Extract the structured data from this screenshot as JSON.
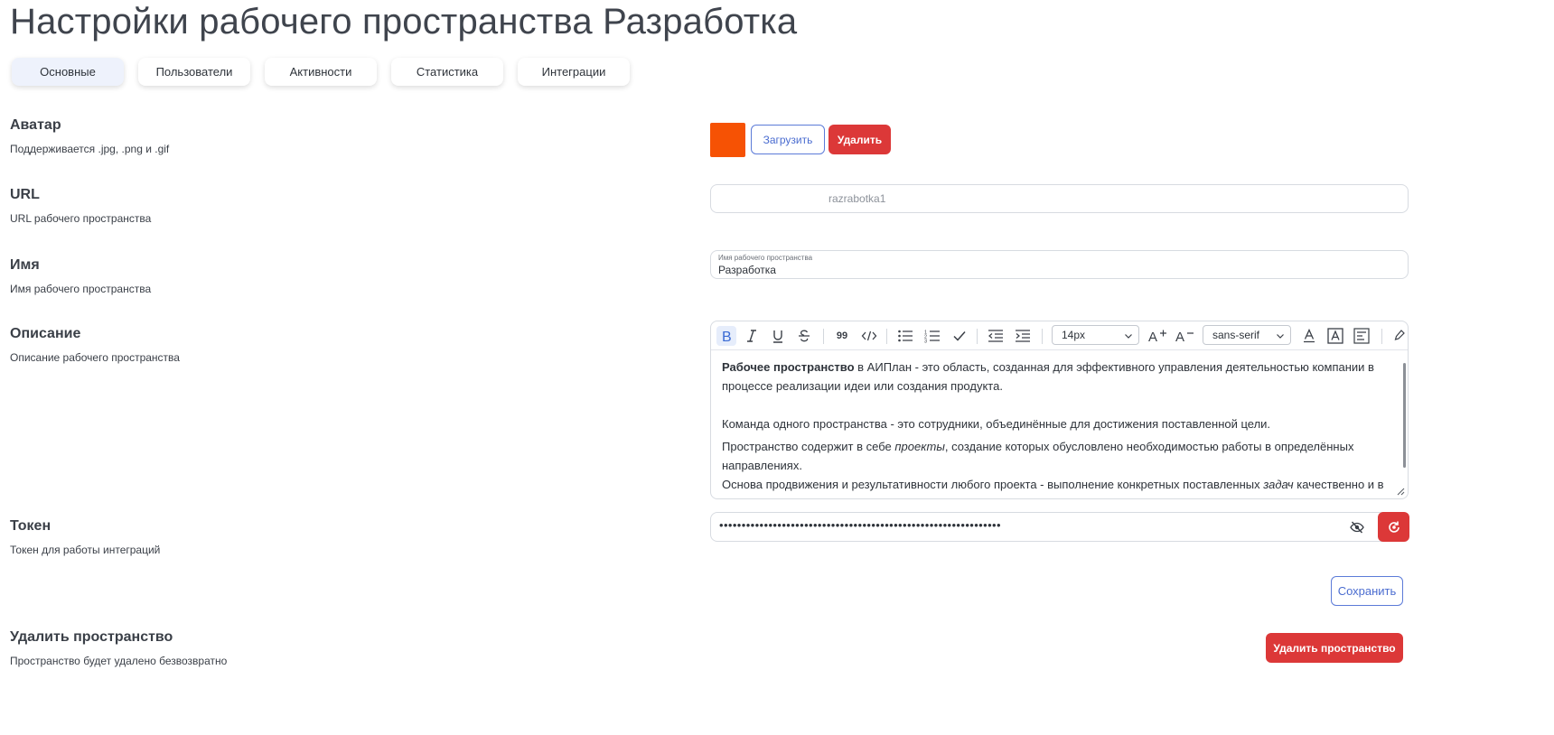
{
  "page_title": "Настройки рабочего пространства Разработка",
  "tabs": [
    {
      "label": "Основные",
      "active": true
    },
    {
      "label": "Пользователи",
      "active": false
    },
    {
      "label": "Активности",
      "active": false
    },
    {
      "label": "Статистика",
      "active": false
    },
    {
      "label": "Интеграции",
      "active": false
    }
  ],
  "avatar": {
    "title": "Аватар",
    "description": "Поддерживается .jpg, .png и .gif",
    "color": "#f65204",
    "upload_label": "Загрузить",
    "delete_label": "Удалить"
  },
  "url": {
    "title": "URL",
    "description": "URL рабочего пространства",
    "value": "razrabotka1"
  },
  "name": {
    "title": "Имя",
    "description": "Имя рабочего пространства",
    "field_label": "Имя рабочего пространства",
    "value": "Разработка"
  },
  "description": {
    "title": "Описание",
    "subtitle": "Описание рабочего пространства",
    "toolbar": {
      "font_size": "14px",
      "font_family": "sans-serif",
      "quote_label": "99"
    },
    "content": {
      "p1_bold": "Рабочее пространство",
      "p1_rest": " в АИПлан - это область, созданная для эффективного управления деятельностью компании в процессе реализации идеи или создания продукта.",
      "p2": "Команда одного пространства - это сотрудники, объединённые для достижения поставленной цели.",
      "p3_a": "Пространство содержит в себе ",
      "p3_em": "проекты",
      "p3_b": ", создание которых обусловлено необходимостью работы в определённых направлениях.",
      "p4_a": "Основа продвижения и результативности любого проекта - выполнение конкретных поставленных ",
      "p4_em": "задач",
      "p4_b": " качественно и в"
    }
  },
  "token": {
    "title": "Токен",
    "description": "Токен для работы интеграций",
    "masked_value": "•••••••••••••••••••••••••••••••••••••••••••••••••••••••••••••••"
  },
  "save_label": "Сохранить",
  "delete_space": {
    "title": "Удалить пространство",
    "description": "Пространство будет удалено безвозвратно",
    "button_label": "Удалить пространство"
  },
  "colors": {
    "accent_blue": "#4a6cd0",
    "danger_red": "#dc3838",
    "avatar_orange": "#f65204"
  }
}
